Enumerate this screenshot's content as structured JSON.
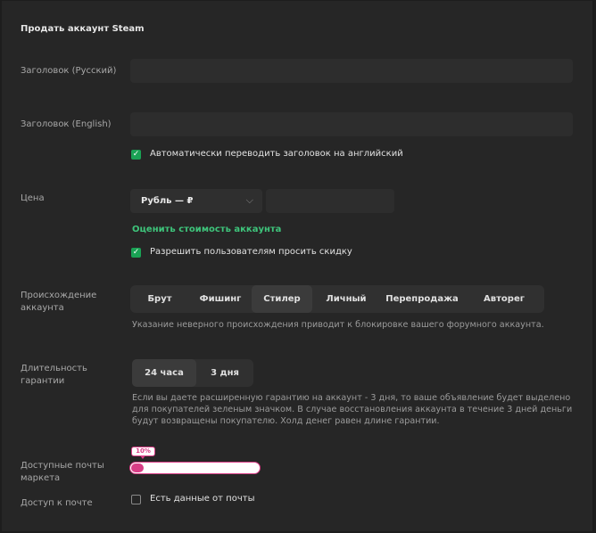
{
  "form": {
    "title": "Продать аккаунт Steam",
    "title_ru_label": "Заголовок (Русский)",
    "title_en_label": "Заголовок (English)",
    "auto_translate_label": "Автоматически переводить заголовок на английский",
    "auto_translate_checked": true,
    "price_label": "Цена",
    "currency_selected": "Рубль — ₽",
    "price_value": "",
    "estimate_link": "Оценить стоимость аккаунта",
    "allow_discount_label": "Разрешить пользователям просить скидку",
    "allow_discount_checked": true,
    "origin_label": "Происхождение аккаунта",
    "origin_options": [
      "Брут",
      "Фишинг",
      "Стилер",
      "Личный",
      "Перепродажа",
      "Авторег"
    ],
    "origin_selected": "Стилер",
    "origin_hint": "Указание неверного происхождения приводит к блокировке вашего форумного аккаунта.",
    "guarantee_label": "Длительность гарантии",
    "guarantee_options": [
      "24 часа",
      "3 дня"
    ],
    "guarantee_selected": "24 часа",
    "guarantee_hint": "Если вы даете расширенную гарантию на аккаунт - 3 дня, то ваше объявление будет выделено для покупателей зеленым значком. В случае восстановления аккаунта в течение 3 дней деньги будут возвращены покупателю. Холд денег равен длине гарантии.",
    "market_mail_label": "Доступные почты маркета",
    "market_mail_percent": 10,
    "market_mail_tooltip": "10%",
    "mail_access_label": "Доступ к почте",
    "mail_data_label": "Есть данные от почты",
    "mail_data_checked": false
  },
  "colors": {
    "accent_green": "#1aa255",
    "link_green": "#3ec47b",
    "accent_pink": "#d83d86"
  }
}
